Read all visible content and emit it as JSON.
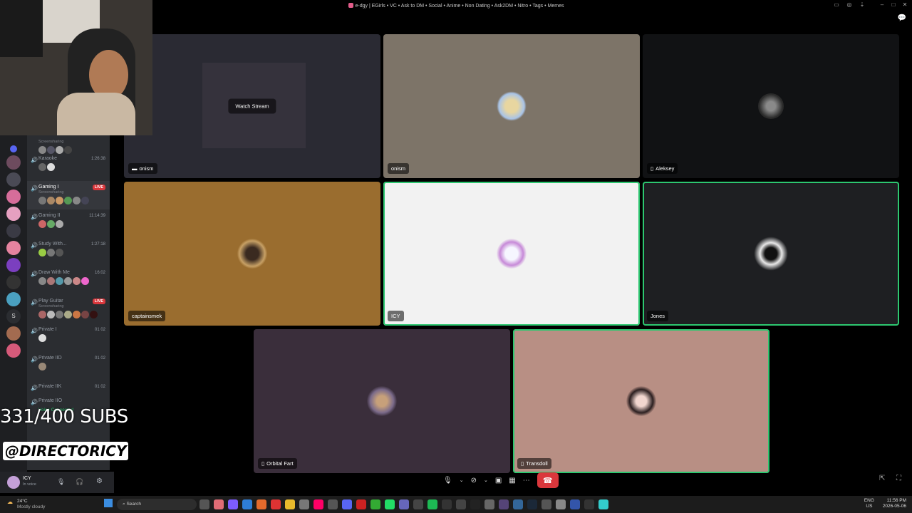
{
  "window": {
    "title": "e-dgy | EGirls • VC • Ask to DM • Social • Anime • Non Dating • Ask2DM • Nitro • Tags • Memes"
  },
  "tiles": [
    {
      "id": "onism-stream",
      "name": "onism",
      "overlay": "Watch Stream",
      "bg": "#2a2a33"
    },
    {
      "id": "onism",
      "name": "onism",
      "bg": "#7d7468"
    },
    {
      "id": "aleksey",
      "name": "Aleksey",
      "bg": "#111214"
    },
    {
      "id": "captainsmek",
      "name": "captainsmek",
      "bg": "#9a6d2f"
    },
    {
      "id": "icy",
      "name": "ICY",
      "bg": "#f2f2f2"
    },
    {
      "id": "jones",
      "name": "Jones",
      "bg": "#1e1f22"
    },
    {
      "id": "orbital",
      "name": "Orbital Fart",
      "bg": "#3a2e3b"
    },
    {
      "id": "transdoll",
      "name": "Transdoll",
      "bg": "#b88f84"
    }
  ],
  "channels": [
    {
      "label": "Screensharing",
      "sub": "",
      "meta": ""
    },
    {
      "label": "Karaoke",
      "meta": "1:26:38"
    },
    {
      "label": "Gaming I",
      "live": "LIVE",
      "sub": "Screensharing"
    },
    {
      "label": "Gaming II",
      "meta": "11:14:39"
    },
    {
      "label": "Study With...",
      "meta": "1:27:18"
    },
    {
      "label": "Draw With Me",
      "meta": "16:02"
    },
    {
      "label": "Play Guitar",
      "live": "LIVE",
      "sub": "Screensharing"
    },
    {
      "label": "Private I",
      "meta": "01 02"
    },
    {
      "label": "Private IID",
      "meta": "01 02"
    },
    {
      "label": "Private IIK",
      "meta": "01 02"
    },
    {
      "label": "Private IIO",
      "meta": ""
    }
  ],
  "user": {
    "name": "ICY",
    "status": "In voice",
    "voice_status": "Voice Connected"
  },
  "overlay": {
    "subs": "331/400 SUBS",
    "handle": "@DIRECTORICY"
  },
  "taskbar": {
    "weather_temp": "24°C",
    "weather_desc": "Mostly cloudy",
    "search": "Search",
    "lang": "ENG",
    "region": "US",
    "time": "11:56 PM",
    "date": "2026-05-06"
  },
  "colors": {
    "accent_green": "#2dc770",
    "hangup_red": "#da373c",
    "live_red": "#da373c"
  }
}
